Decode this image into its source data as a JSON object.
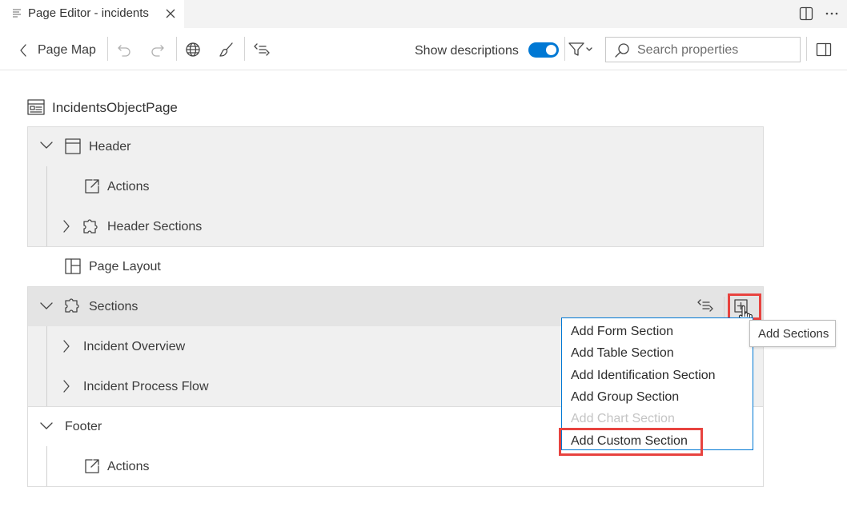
{
  "tab": {
    "title": "Page Editor - incidents"
  },
  "toolbar": {
    "back_label": "Page Map",
    "show_descriptions_label": "Show descriptions",
    "show_descriptions_on": true,
    "search_placeholder": "Search properties"
  },
  "outline": {
    "page_title": "IncidentsObjectPage",
    "header": {
      "label": "Header",
      "actions": "Actions",
      "sections": "Header Sections"
    },
    "page_layout": "Page Layout",
    "sections": {
      "label": "Sections",
      "items": [
        "Incident Overview",
        "Incident Process Flow"
      ]
    },
    "footer": {
      "label": "Footer",
      "actions": "Actions"
    }
  },
  "menu": {
    "items": [
      {
        "label": "Add Form Section",
        "enabled": true
      },
      {
        "label": "Add Table Section",
        "enabled": true
      },
      {
        "label": "Add Identification Section",
        "enabled": true
      },
      {
        "label": "Add Group Section",
        "enabled": true
      },
      {
        "label": "Add Chart Section",
        "enabled": false
      },
      {
        "label": "Add Custom Section",
        "enabled": true
      }
    ]
  },
  "tooltip": {
    "text": "Add Sections"
  },
  "colors": {
    "accent": "#0078d4",
    "highlight": "#e8433f",
    "panel": "#f0f0f0"
  },
  "icons": [
    "editor-file-icon",
    "close-icon",
    "split-editor-icon",
    "more-icon",
    "chevron-left-icon",
    "undo-icon",
    "redo-icon",
    "globe-icon",
    "brush-icon",
    "outline-icon",
    "filter-icon",
    "search-icon",
    "panel-icon",
    "page-icon",
    "chevron-down-icon",
    "chevron-right-icon",
    "header-layout-icon",
    "external-link-icon",
    "puzzle-icon",
    "layout-grid-icon",
    "add-square-icon",
    "cursor-hand-icon"
  ]
}
